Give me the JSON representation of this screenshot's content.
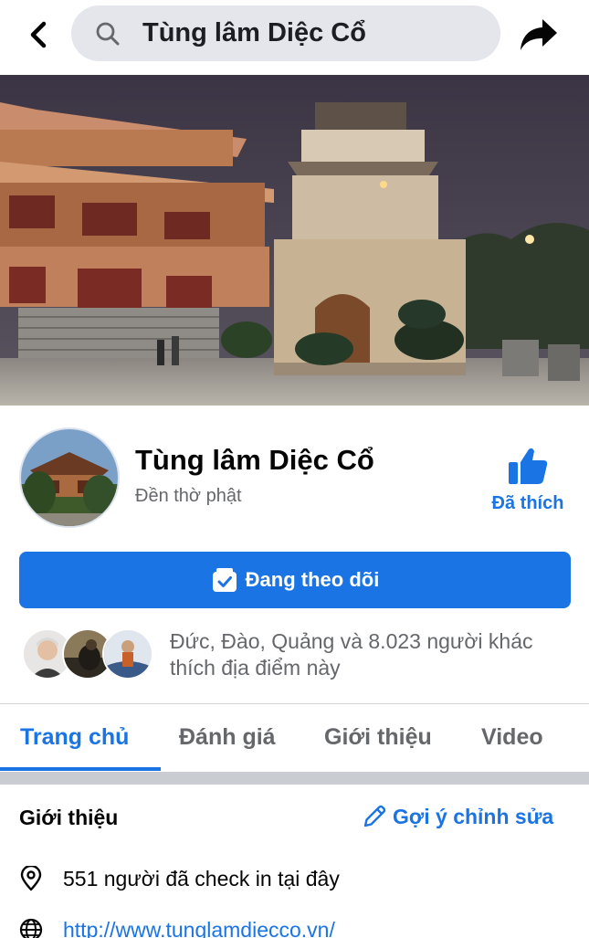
{
  "header": {
    "search_query": "Tùng lâm Diệc Cổ",
    "icons": [
      "back-arrow-icon",
      "search-icon",
      "share-arrow-icon"
    ]
  },
  "profile": {
    "name": "Tùng lâm Diệc Cổ",
    "category": "Đền thờ phật",
    "liked_label": "Đã thích",
    "follow_label": "Đang theo dõi"
  },
  "likes": {
    "text": "Đức, Đào, Quảng và 8.023 người khác thích địa điểm này"
  },
  "tabs": [
    {
      "label": "Trang chủ",
      "active": true
    },
    {
      "label": "Đánh giá",
      "active": false
    },
    {
      "label": "Giới thiệu",
      "active": false
    },
    {
      "label": "Video",
      "active": false
    }
  ],
  "about": {
    "title": "Giới thiệu",
    "edit_label": "Gợi ý chỉnh sửa",
    "checkin_text": "551 người đã check in tại đây",
    "website": "http://www.tunglamdiecco.vn/"
  },
  "colors": {
    "accent": "#1b74e4",
    "secondary_text": "#65676b",
    "search_bg": "#e4e6eb"
  }
}
